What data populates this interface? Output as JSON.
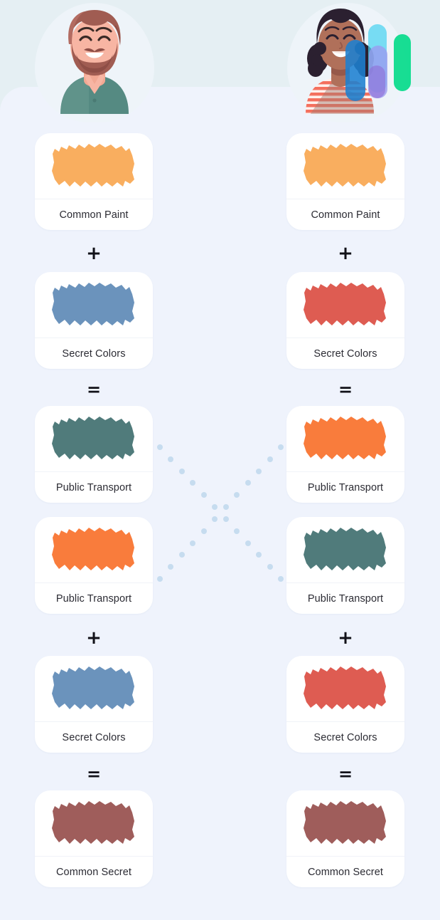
{
  "theme": {
    "background_top": "#e5eff3",
    "panel_background": "#eff3fc",
    "card_background": "#ffffff",
    "label_color": "#2b2b33",
    "dot_color": "#c6dcef"
  },
  "avatars": [
    {
      "name": "bearded-man-avatar",
      "side": "left",
      "hair_color": "#a05c52",
      "skin_color": "#f7b5a3",
      "shirt_color": "#558a82"
    },
    {
      "name": "woman-with-color-bars-avatar",
      "side": "right",
      "hair_color": "#2b2030",
      "skin_color": "#b0705a",
      "shirt_color": "#f4705e"
    }
  ],
  "bars": [
    {
      "name": "blue-bar",
      "color": "#1d7fd0"
    },
    {
      "name": "cyan-bar",
      "color": "#4ad3f0"
    },
    {
      "name": "periwinkle-bar",
      "color": "#9b9bf0"
    },
    {
      "name": "green-bar",
      "color": "#0cdb8d"
    },
    {
      "name": "violet-bar",
      "color": "#8f6fd6"
    }
  ],
  "operators": {
    "plus": "+",
    "equals": "="
  },
  "columns": [
    {
      "name": "left-column",
      "steps": [
        {
          "label": "Common Paint",
          "color": "#f9ae5f",
          "swatch": "common-paint-swatch"
        },
        {
          "op": "+"
        },
        {
          "label": "Secret Colors",
          "color": "#6b93bc",
          "swatch": "secret-colors-swatch"
        },
        {
          "op": "="
        },
        {
          "label": "Public Transport",
          "color": "#507b7b",
          "swatch": "public-transport-swatch"
        },
        {
          "label": "Public Transport",
          "color": "#f97c3c",
          "swatch": "public-transport-swatch"
        },
        {
          "op": "+"
        },
        {
          "label": "Secret Colors",
          "color": "#6b93bc",
          "swatch": "secret-colors-swatch"
        },
        {
          "op": "="
        },
        {
          "label": "Common Secret",
          "color": "#9f5d5b",
          "swatch": "common-secret-swatch"
        }
      ]
    },
    {
      "name": "right-column",
      "steps": [
        {
          "label": "Common Paint",
          "color": "#f9ae5f",
          "swatch": "common-paint-swatch"
        },
        {
          "op": "+"
        },
        {
          "label": "Secret Colors",
          "color": "#de5c52",
          "swatch": "secret-colors-swatch"
        },
        {
          "op": "="
        },
        {
          "label": "Public Transport",
          "color": "#f97c3c",
          "swatch": "public-transport-swatch"
        },
        {
          "label": "Public Transport",
          "color": "#507b7b",
          "swatch": "public-transport-swatch"
        },
        {
          "op": "+"
        },
        {
          "label": "Secret Colors",
          "color": "#de5c52",
          "swatch": "secret-colors-swatch"
        },
        {
          "op": "="
        },
        {
          "label": "Common Secret",
          "color": "#9f5d5b",
          "swatch": "common-secret-swatch"
        }
      ]
    }
  ],
  "crossing": {
    "name": "dotted-exchange-x",
    "dots_per_diagonal": 12
  }
}
